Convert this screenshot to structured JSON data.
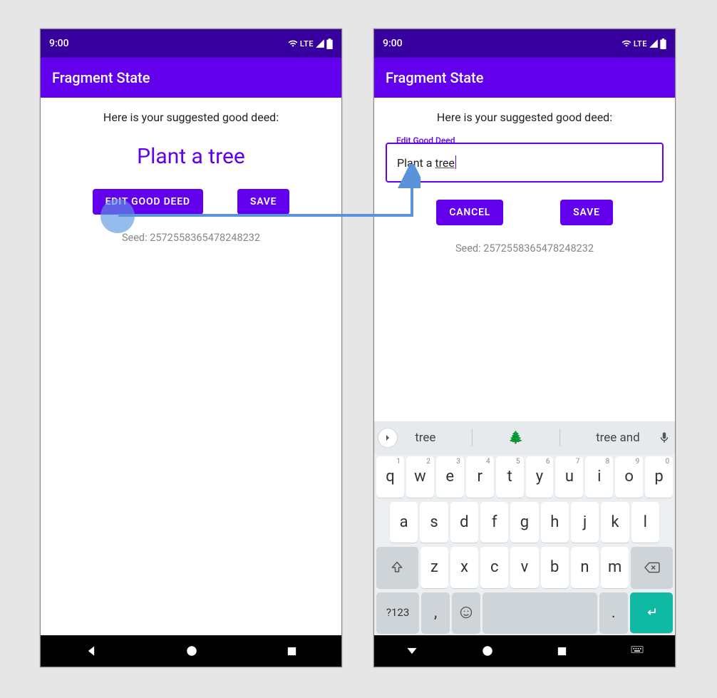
{
  "status": {
    "time": "9:00",
    "lte": "LTE"
  },
  "app_title": "Fragment State",
  "prompt": "Here is your suggested good deed:",
  "left": {
    "deed": "Plant a tree",
    "buttons": {
      "edit": "EDIT GOOD DEED",
      "save": "SAVE"
    },
    "seed": "Seed: 2572558365478248232"
  },
  "right": {
    "field_label": "Edit Good Deed",
    "field_value_prefix": "Plant a ",
    "field_value_underlined": "tree",
    "buttons": {
      "cancel": "CANCEL",
      "save": "SAVE"
    },
    "seed": "Seed: 2572558365478248232"
  },
  "keyboard": {
    "suggestions": [
      "tree",
      "🌲",
      "tree and"
    ],
    "row1": [
      {
        "k": "q",
        "h": "1"
      },
      {
        "k": "w",
        "h": "2"
      },
      {
        "k": "e",
        "h": "3"
      },
      {
        "k": "r",
        "h": "4"
      },
      {
        "k": "t",
        "h": "5"
      },
      {
        "k": "y",
        "h": "6"
      },
      {
        "k": "u",
        "h": "7"
      },
      {
        "k": "i",
        "h": "8"
      },
      {
        "k": "o",
        "h": "9"
      },
      {
        "k": "p",
        "h": "0"
      }
    ],
    "row2": [
      "a",
      "s",
      "d",
      "f",
      "g",
      "h",
      "j",
      "k",
      "l"
    ],
    "row3": [
      "z",
      "x",
      "c",
      "v",
      "b",
      "n",
      "m"
    ],
    "symbols_key": "?123",
    "comma_key": ",",
    "period_key": "."
  }
}
